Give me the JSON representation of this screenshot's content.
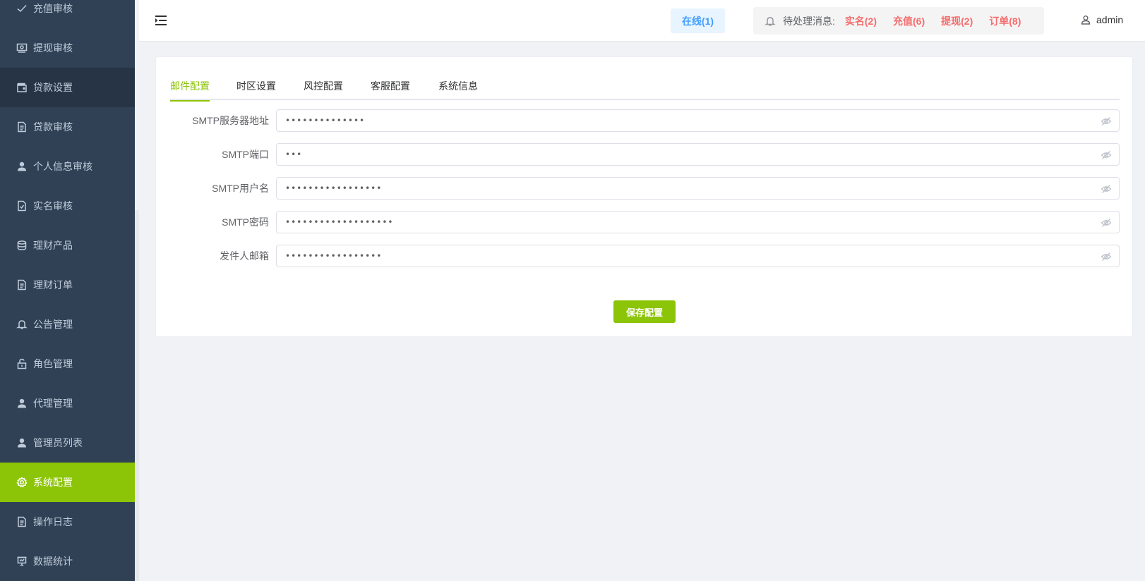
{
  "sidebar": {
    "items": [
      {
        "label": "充值审核",
        "icon": "check-icon"
      },
      {
        "label": "提现审核",
        "icon": "money-icon"
      },
      {
        "label": "贷款设置",
        "icon": "wallet-icon"
      },
      {
        "label": "贷款审核",
        "icon": "document-icon"
      },
      {
        "label": "个人信息审核",
        "icon": "user-icon"
      },
      {
        "label": "实名审核",
        "icon": "document-check-icon"
      },
      {
        "label": "理财产品",
        "icon": "coins-icon"
      },
      {
        "label": "理财订单",
        "icon": "document-icon"
      },
      {
        "label": "公告管理",
        "icon": "bell-icon"
      },
      {
        "label": "角色管理",
        "icon": "unlock-icon"
      },
      {
        "label": "代理管理",
        "icon": "user-icon"
      },
      {
        "label": "管理员列表",
        "icon": "user-icon"
      },
      {
        "label": "系统配置",
        "icon": "gear-icon"
      },
      {
        "label": "操作日志",
        "icon": "document-icon"
      },
      {
        "label": "数据统计",
        "icon": "presentation-chart-icon"
      }
    ],
    "active_item": "系统配置",
    "colors": {
      "background": "#304156",
      "active": "#8cc407",
      "text": "#bfcbd9"
    }
  },
  "header": {
    "online_label": "在线(1)",
    "pending_label": "待处理消息:",
    "pending_links": [
      "实名(2)",
      "充值(6)",
      "提现(2)",
      "订单(8)"
    ],
    "username": "admin"
  },
  "tabs": [
    {
      "label": "邮件配置",
      "active": true
    },
    {
      "label": "时区设置",
      "active": false
    },
    {
      "label": "风控配置",
      "active": false
    },
    {
      "label": "客服配置",
      "active": false
    },
    {
      "label": "系统信息",
      "active": false
    }
  ],
  "form": {
    "fields": [
      {
        "label": "SMTP服务器地址",
        "value": "••••••••••••••"
      },
      {
        "label": "SMTP端口",
        "value": "•••"
      },
      {
        "label": "SMTP用户名",
        "value": "•••••••••••••••••"
      },
      {
        "label": "SMTP密码",
        "value": "•••••••••••••••••••"
      },
      {
        "label": "发件人邮箱",
        "value": "•••••••••••••••••"
      }
    ],
    "save_label": "保存配置"
  },
  "colors": {
    "accent": "#8cc407",
    "danger": "#f56c6c",
    "primary": "#409eff"
  }
}
